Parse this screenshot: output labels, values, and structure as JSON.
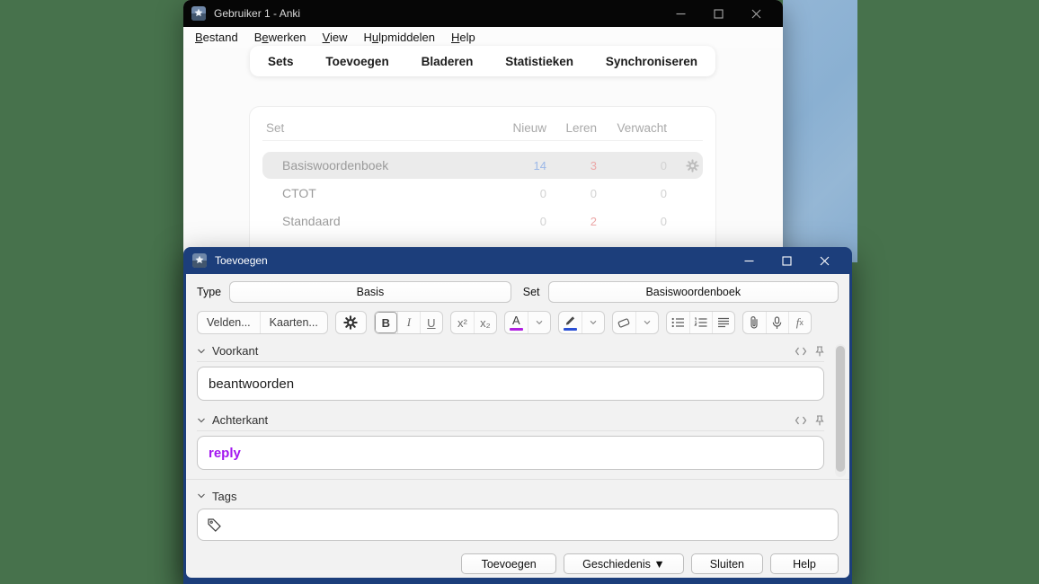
{
  "colors": {
    "desktop_green": "#47724c",
    "wallpaper_blue": "#8fb2d4",
    "dialog_titlebar_navy": "#1c3e7b",
    "main_titlebar_black": "#060606",
    "field_text_purple": "#a316f0",
    "new_count_blue": "#9cb8e8",
    "learn_count_red": "#eba7a7"
  },
  "icons": {
    "app": "anki-star",
    "gear": "gear",
    "text_color": "A-with-color-bar",
    "highlight": "pen",
    "remove_format": "eraser",
    "lists": [
      "bullet-list",
      "numbered-list",
      "justify"
    ],
    "media": [
      "paperclip",
      "microphone"
    ],
    "field_head": [
      "chevron-down",
      "code-brackets",
      "pushpin"
    ],
    "tags": "tag-outline"
  },
  "main_window": {
    "title": "Gebruiker 1 - Anki",
    "menu": {
      "items": [
        {
          "pre": "",
          "u": "B",
          "post": "estand"
        },
        {
          "pre": "B",
          "u": "e",
          "post": "werken"
        },
        {
          "pre": "",
          "u": "V",
          "post": "iew"
        },
        {
          "pre": "H",
          "u": "u",
          "post": "lpmiddelen"
        },
        {
          "pre": "",
          "u": "H",
          "post": "elp"
        }
      ]
    },
    "tabs": [
      "Sets",
      "Toevoegen",
      "Bladeren",
      "Statistieken",
      "Synchroniseren"
    ],
    "table": {
      "headers": {
        "set": "Set",
        "nieuw": "Nieuw",
        "leren": "Leren",
        "verwacht": "Verwacht"
      },
      "rows": [
        {
          "name": "Basiswoordenboek",
          "nieuw": "14",
          "leren": "3",
          "verwacht": "0"
        },
        {
          "name": "CTOT",
          "nieuw": "0",
          "leren": "0",
          "verwacht": "0"
        },
        {
          "name": "Standaard",
          "nieuw": "0",
          "leren": "2",
          "verwacht": "0"
        }
      ]
    }
  },
  "dialog": {
    "title": "Toevoegen",
    "type_label": "Type",
    "type_value": "Basis",
    "set_label": "Set",
    "set_value": "Basiswoordenboek",
    "toolbar": {
      "fields_button": "Velden...",
      "cards_button": "Kaarten...",
      "bold": "B",
      "italic": "I",
      "underline": "U",
      "superscript": "x²",
      "subscript": "x₂",
      "color_letter": "A",
      "math_f": "f",
      "math_x": "x"
    },
    "fields": [
      {
        "label": "Voorkant",
        "value": "beantwoorden",
        "value_style": ""
      },
      {
        "label": "Achterkant",
        "value": "reply",
        "value_style": "color:#a316f0;font-weight:700"
      }
    ],
    "tags_label": "Tags",
    "tags_value": "",
    "buttons": {
      "add": "Toevoegen",
      "history": "Geschiedenis ▼",
      "close": "Sluiten",
      "help": "Help"
    }
  }
}
